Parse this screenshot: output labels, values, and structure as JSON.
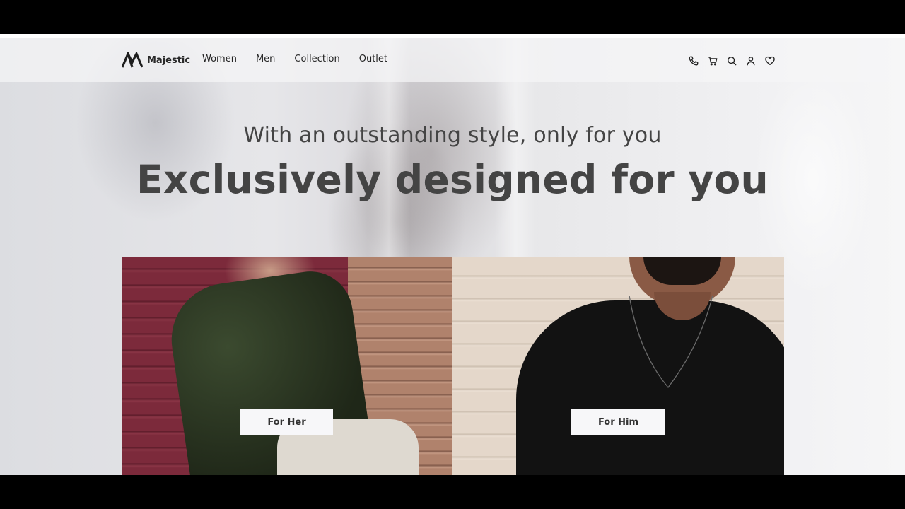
{
  "brand": {
    "name": "Majestic"
  },
  "nav": {
    "items": [
      {
        "label": "Women"
      },
      {
        "label": "Men"
      },
      {
        "label": "Collection"
      },
      {
        "label": "Outlet"
      }
    ],
    "icons": [
      "phone-icon",
      "cart-icon",
      "search-icon",
      "user-icon",
      "heart-icon"
    ]
  },
  "hero": {
    "subtitle": "With an outstanding style, only for you",
    "headline": "Exclusively designed for you"
  },
  "panels": [
    {
      "button_label": "For Her"
    },
    {
      "button_label": "For Him"
    }
  ],
  "colors": {
    "text_dark": "#444444",
    "button_bg": "#f7f7f9"
  }
}
